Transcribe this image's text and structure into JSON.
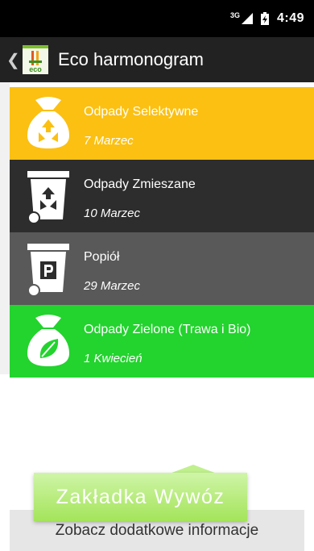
{
  "status_bar": {
    "signal_label": "3G",
    "time": "4:49"
  },
  "app_bar": {
    "logo_text": "eco",
    "title": "Eco harmonogram"
  },
  "items": [
    {
      "name": "Odpady Selektywne",
      "date": "7 Marzec",
      "color": "#fbc012",
      "icon": "recycling-bag-icon"
    },
    {
      "name": "Odpady Zmieszane",
      "date": "10 Marzec",
      "color": "#2d2d2d",
      "icon": "recycling-bin-icon"
    },
    {
      "name": "Popiół",
      "date": "29 Marzec",
      "color": "#595959",
      "icon": "ash-bin-icon"
    },
    {
      "name": "Odpady Zielone (Trawa i Bio)",
      "date": "1 Kwiecień",
      "color": "#23d32e",
      "icon": "leaf-bag-icon"
    }
  ],
  "tooltip": {
    "text": "Zakładka Wywóz"
  },
  "footer": {
    "text": "Zobacz dodatkowe informacje"
  }
}
